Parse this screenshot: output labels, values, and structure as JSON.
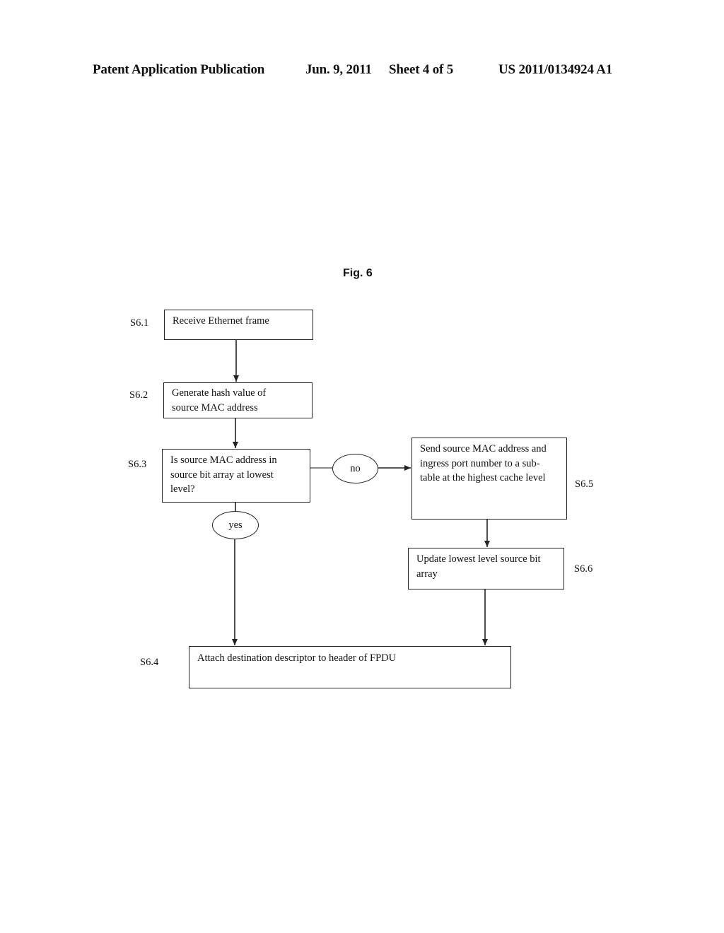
{
  "header": {
    "publication_type": "Patent Application Publication",
    "date": "Jun. 9, 2011",
    "sheet": "Sheet 4 of 5",
    "publication_number": "US 2011/0134924 A1"
  },
  "figure": {
    "title": "Fig. 6"
  },
  "steps": {
    "s61": {
      "id": "S6.1",
      "text": "Receive Ethernet frame"
    },
    "s62": {
      "id": "S6.2",
      "line1": "Generate hash value of",
      "line2": "source MAC address"
    },
    "s63": {
      "id": "S6.3",
      "line1": "Is source MAC address in",
      "line2": "source bit array at lowest",
      "line3": "level?"
    },
    "s65": {
      "id": "S6.5",
      "line1": "Send source MAC address and",
      "line2": "ingress port number to a sub-",
      "line3": "table at the highest cache level"
    },
    "s66": {
      "id": "S6.6",
      "line1": "Update lowest level source bit",
      "line2": "array"
    },
    "s64": {
      "id": "S6.4",
      "text": "Attach destination descriptor to header of FPDU"
    }
  },
  "decisions": {
    "no": "no",
    "yes": "yes"
  },
  "flow": [
    {
      "from": "S6.1",
      "to": "S6.2"
    },
    {
      "from": "S6.2",
      "to": "S6.3"
    },
    {
      "from": "S6.3",
      "to": "S6.5",
      "condition": "no"
    },
    {
      "from": "S6.3",
      "to": "S6.4",
      "condition": "yes"
    },
    {
      "from": "S6.5",
      "to": "S6.6"
    },
    {
      "from": "S6.6",
      "to": "S6.4"
    }
  ]
}
